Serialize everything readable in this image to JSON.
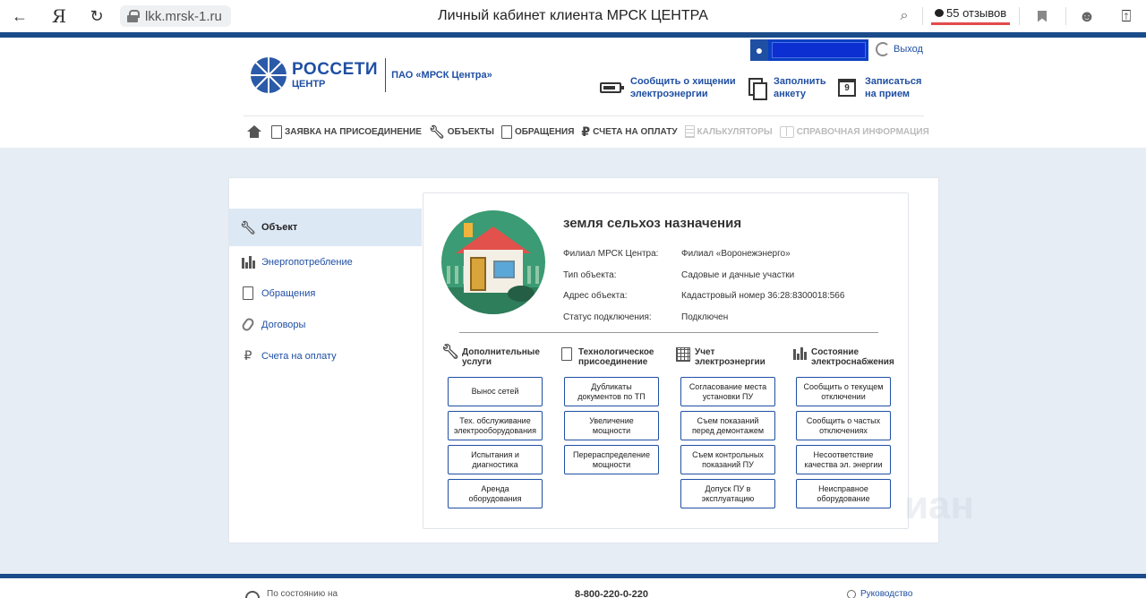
{
  "browser": {
    "url": "lkk.mrsk-1.ru",
    "title": "Личный кабинет клиента МРСК ЦЕНТРА",
    "ya_label": "Я",
    "reviews_label": "55 отзывов"
  },
  "header": {
    "logout_label": "Выход",
    "logo_brand": "РОССЕТИ",
    "logo_sub": "ЦЕНТР",
    "company": "ПАО «МРСК Центра»",
    "links": [
      {
        "line1": "Сообщить о хищении",
        "line2": "электроэнергии"
      },
      {
        "line1": "Заполнить",
        "line2": "анкету"
      },
      {
        "line1": "Записаться",
        "line2": "на прием"
      }
    ],
    "calendar_day": "9",
    "nav": [
      "ЗАЯВКА НА ПРИСОЕДИНЕНИЕ",
      "ОБЪЕКТЫ",
      "ОБРАЩЕНИЯ",
      "СЧЕТА НА ОПЛАТУ",
      "КАЛЬКУЛЯТОРЫ",
      "СПРАВОЧНАЯ ИНФОРМАЦИЯ"
    ]
  },
  "sidebar": {
    "items": [
      "Объект",
      "Энергопотребление",
      "Обращения",
      "Договоры",
      "Счета на оплату"
    ]
  },
  "object": {
    "title": "земля сельхоз назначения",
    "props": [
      {
        "label": "Филиал МРСК Центра:",
        "value": "Филиал «Воронежэнерго»"
      },
      {
        "label": "Тип объекта:",
        "value": "Садовые и дачные участки"
      },
      {
        "label": "Адрес объекта:",
        "value": "Кадастровый номер 36:28:8300018:566"
      },
      {
        "label": "Статус подключения:",
        "value": "Подключен"
      }
    ]
  },
  "columns": [
    {
      "head1": "Дополнительные",
      "head2": "услуги",
      "buttons": [
        {
          "l1": "Вынос сетей",
          "l2": ""
        },
        {
          "l1": "Тех. обслуживание",
          "l2": "электрооборудования"
        },
        {
          "l1": "Испытания и",
          "l2": "диагностика"
        },
        {
          "l1": "Аренда",
          "l2": "оборудования"
        }
      ]
    },
    {
      "head1": "Технологическое",
      "head2": "присоединение",
      "buttons": [
        {
          "l1": "Дубликаты",
          "l2": "документов по ТП"
        },
        {
          "l1": "Увеличение",
          "l2": "мощности"
        },
        {
          "l1": "Перераспределение",
          "l2": "мощности"
        }
      ]
    },
    {
      "head1": "Учет",
      "head2": "электроэнергии",
      "buttons": [
        {
          "l1": "Согласование места",
          "l2": "установки ПУ"
        },
        {
          "l1": "Съем показаний",
          "l2": "перед демонтажем"
        },
        {
          "l1": "Съем контрольных",
          "l2": "показаний ПУ"
        },
        {
          "l1": "Допуск ПУ в",
          "l2": "эксплуатацию"
        }
      ]
    },
    {
      "head1": "Состояние",
      "head2": "электроснабжения",
      "buttons": [
        {
          "l1": "Сообщить о текущем",
          "l2": "отключении"
        },
        {
          "l1": "Сообщить о частых",
          "l2": "отключениях"
        },
        {
          "l1": "Несоответствие",
          "l2": "качества эл. энергии"
        },
        {
          "l1": "Неисправное",
          "l2": "оборудование"
        }
      ]
    }
  ],
  "footer": {
    "status_text": "По состоянию на",
    "phone": "8-800-220-0-220",
    "guide_label": "Руководство"
  }
}
